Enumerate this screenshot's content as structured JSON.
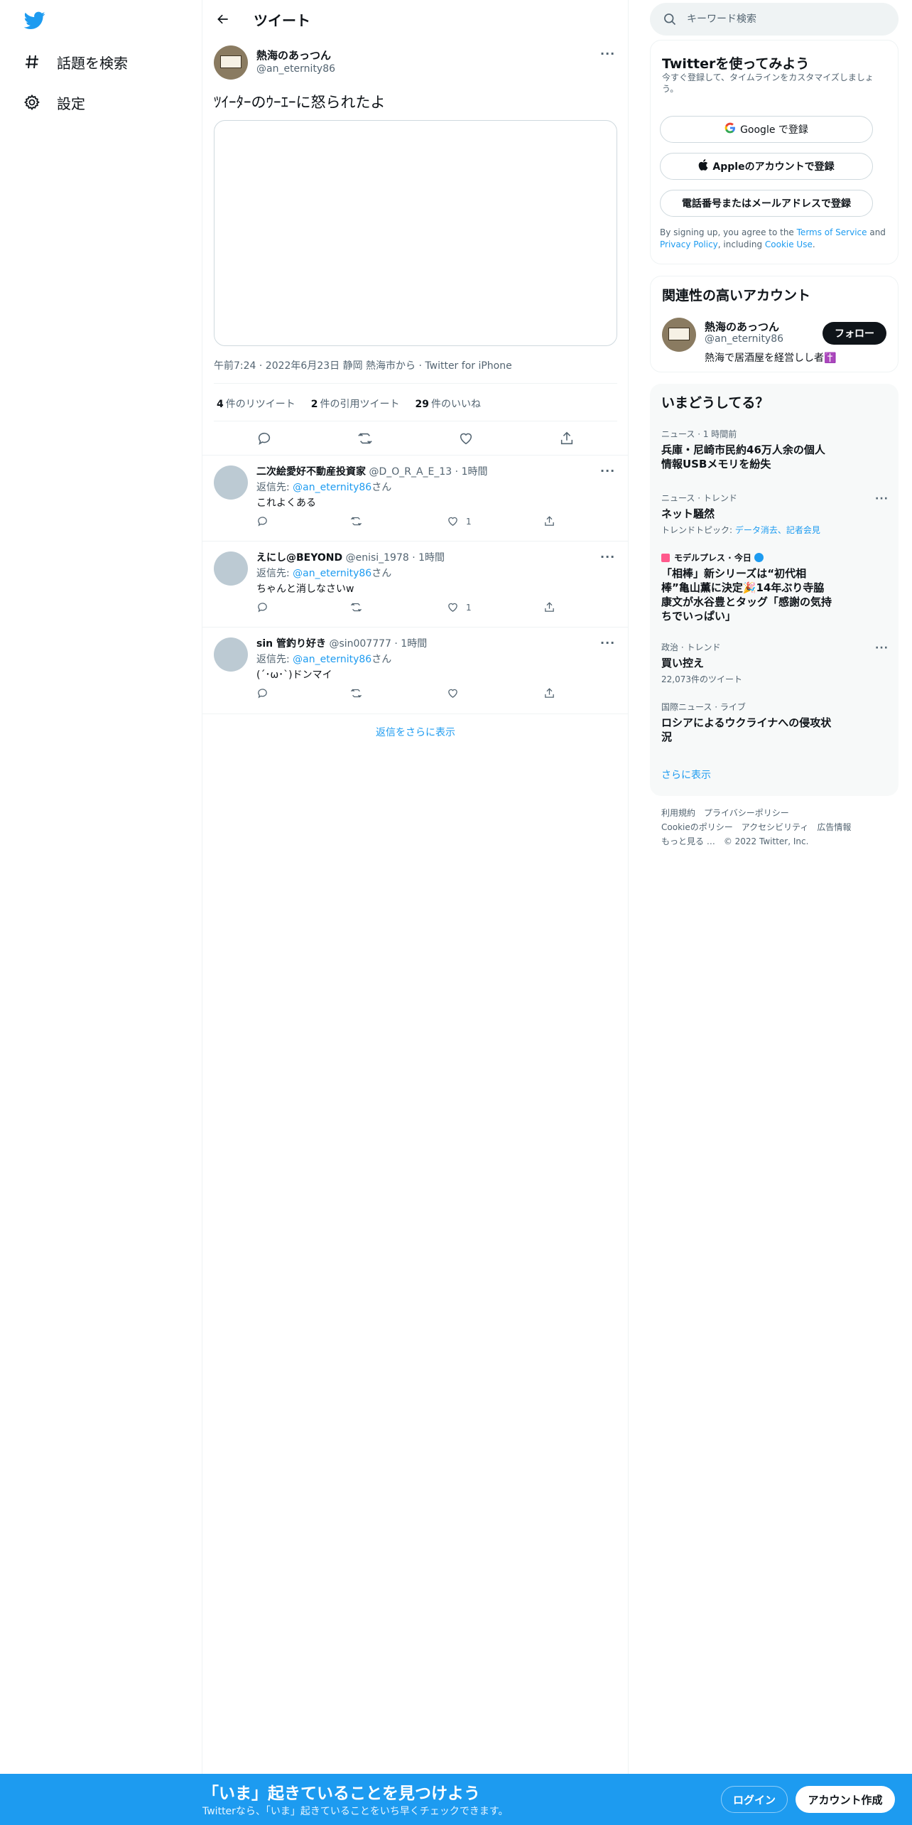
{
  "nav": {
    "items": [
      {
        "label": "話題を検索",
        "icon": "hashtag-icon"
      },
      {
        "label": "設定",
        "icon": "gear-icon"
      }
    ]
  },
  "header": {
    "title": "ツイート"
  },
  "tweet": {
    "author_name": "熱海のあっつん",
    "author_handle": "@an_eternity86",
    "text": "ﾂｲｰﾀｰのｳｰｴｰに怒られたよ",
    "meta": "午前7:24 · 2022年6月23日 静岡 熱海市から · Twitter for iPhone",
    "stats": [
      {
        "count": "4",
        "label": "件のリツイート"
      },
      {
        "count": "2",
        "label": "件の引用ツイート"
      },
      {
        "count": "29",
        "label": "件のいいね"
      }
    ]
  },
  "replies": [
    {
      "name": "二次絵愛好不動産投資家",
      "handle": "@D_O_R_A_E_13",
      "time": "· 1時間",
      "reply_to_prefix": "返信先: ",
      "reply_to": "@an_eternity86",
      "reply_to_suffix": "さん",
      "text": "これよくある",
      "likes": "1"
    },
    {
      "name": "えにし@BEYOND",
      "handle": "@enisi_1978",
      "time": "· 1時間",
      "reply_to_prefix": "返信先: ",
      "reply_to": "@an_eternity86",
      "reply_to_suffix": "さん",
      "text": "ちゃんと消しなさいw",
      "likes": "1"
    },
    {
      "name": "sin 管釣り好き",
      "handle": "@sin007777",
      "time": "· 1時間",
      "reply_to_prefix": "返信先: ",
      "reply_to": "@an_eternity86",
      "reply_to_suffix": "さん",
      "text": "(´･ω･`)ドンマイ",
      "likes": ""
    }
  ],
  "show_more_replies": "返信をさらに表示",
  "search": {
    "placeholder": "キーワード検索"
  },
  "signup_card": {
    "title": "Twitterを使ってみよう",
    "subtitle": "今すぐ登録して、タイムラインをカスタマイズしましょう。",
    "google_button": "Google で登録",
    "apple_button": "Appleのアカウントで登録",
    "phone_button": "電話番号またはメールアドレスで登録",
    "legal_prefix": "By signing up, you agree to the ",
    "terms_link": "Terms of Service",
    "legal_and": " and ",
    "privacy_link": "Privacy Policy",
    "legal_including": ", including ",
    "cookie_link": "Cookie Use",
    "legal_end": "."
  },
  "related": {
    "title": "関連性の高いアカウント",
    "name": "熱海のあっつん",
    "handle": "@an_eternity86",
    "bio": "熱海で居酒屋を経営しし者✝️",
    "follow_label": "フォロー"
  },
  "trends": {
    "title": "いまどうしてる？",
    "items": [
      {
        "context": "ニュース · 1 時間前",
        "title": "兵庫・尼崎市民約46万人余の個人情報USBメモリを紛失",
        "sub": "",
        "sub_prefix": "",
        "sub_links": ""
      },
      {
        "context": "ニュース · トレンド",
        "title": "ネット騒然",
        "sub_prefix": "トレンドトピック: ",
        "sub_links": "データ消去、記者会見"
      },
      {
        "context": "モデルプレス · 今日",
        "title": "「相棒」新シリーズは“初代相棒”亀山薫に決定🎉14年ぶり寺脇康文が水谷豊とタッグ「感謝の気持ちでいっぱい」",
        "sub_prefix": "",
        "sub_links": ""
      },
      {
        "context": "政治 · トレンド",
        "title": "買い控え",
        "sub_prefix": "22,073件のツイート",
        "sub_links": ""
      },
      {
        "context": "国際ニュース · ライブ",
        "title": "ロシアによるウクライナへの侵攻状況",
        "sub_prefix": "",
        "sub_links": ""
      }
    ],
    "show_more": "さらに表示"
  },
  "footer": {
    "links": [
      "利用規約",
      "プライバシーポリシー",
      "Cookieのポリシー",
      "アクセシビリティ",
      "広告情報",
      "もっと見る …",
      "© 2022 Twitter, Inc."
    ]
  },
  "bottom_bar": {
    "title": "「いま」起きていることを見つけよう",
    "subtitle": "Twitterなら、「いま」起きていることをいち早くチェックできます。",
    "login": "ログイン",
    "signup": "アカウント作成"
  },
  "colors": {
    "accent": "#1d9bf0",
    "text": "#0f1419",
    "muted": "#536471"
  }
}
